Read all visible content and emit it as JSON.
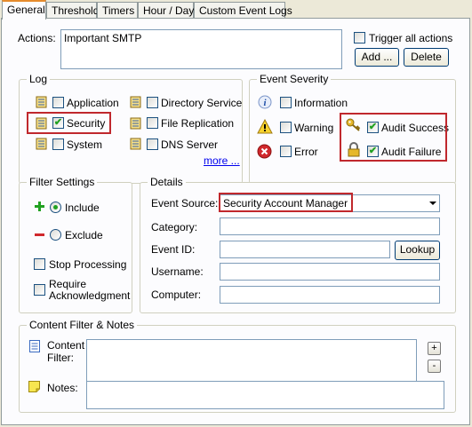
{
  "tabs": [
    "General",
    "Threshold",
    "Timers",
    "Hour / Day",
    "Custom Event Logs"
  ],
  "actions": {
    "label": "Actions:",
    "value": "Important SMTP",
    "trigger_all_label": "Trigger all actions",
    "trigger_all_checked": false,
    "add_label": "Add ...",
    "delete_label": "Delete"
  },
  "log": {
    "title": "Log",
    "items": [
      {
        "label": "Application",
        "checked": false
      },
      {
        "label": "Security",
        "checked": true
      },
      {
        "label": "System",
        "checked": false
      },
      {
        "label": "Directory Service",
        "checked": false
      },
      {
        "label": "File Replication",
        "checked": false
      },
      {
        "label": "DNS Server",
        "checked": false
      }
    ],
    "more_label": "more ..."
  },
  "severity": {
    "title": "Event Severity",
    "items": [
      {
        "label": "Information",
        "checked": false,
        "icon": "info-icon"
      },
      {
        "label": "Warning",
        "checked": false,
        "icon": "warning-icon"
      },
      {
        "label": "Error",
        "checked": false,
        "icon": "error-icon"
      },
      {
        "label": "Audit Success",
        "checked": true,
        "icon": "key-icon"
      },
      {
        "label": "Audit Failure",
        "checked": true,
        "icon": "lock-icon"
      }
    ]
  },
  "filter": {
    "title": "Filter Settings",
    "include_label": "Include",
    "exclude_label": "Exclude",
    "selected": "Include",
    "stop_processing_label": "Stop Processing",
    "require_ack_label_1": "Require",
    "require_ack_label_2": "Acknowledgment"
  },
  "details": {
    "title": "Details",
    "event_source_label": "Event Source:",
    "event_source_value": "Security Account Manager",
    "category_label": "Category:",
    "category_value": "",
    "event_id_label": "Event ID:",
    "event_id_value": "",
    "lookup_label": "Lookup",
    "username_label": "Username:",
    "username_value": "",
    "computer_label": "Computer:",
    "computer_value": ""
  },
  "content": {
    "title": "Content Filter & Notes",
    "content_filter_label_1": "Content",
    "content_filter_label_2": "Filter:",
    "content_filter_value": "",
    "notes_label": "Notes:",
    "notes_value": "",
    "plus_label": "+",
    "minus_label": "-"
  },
  "colors": {
    "highlight_box": "#c0282d",
    "checkmark": "#21a121",
    "link": "#0000ee"
  }
}
